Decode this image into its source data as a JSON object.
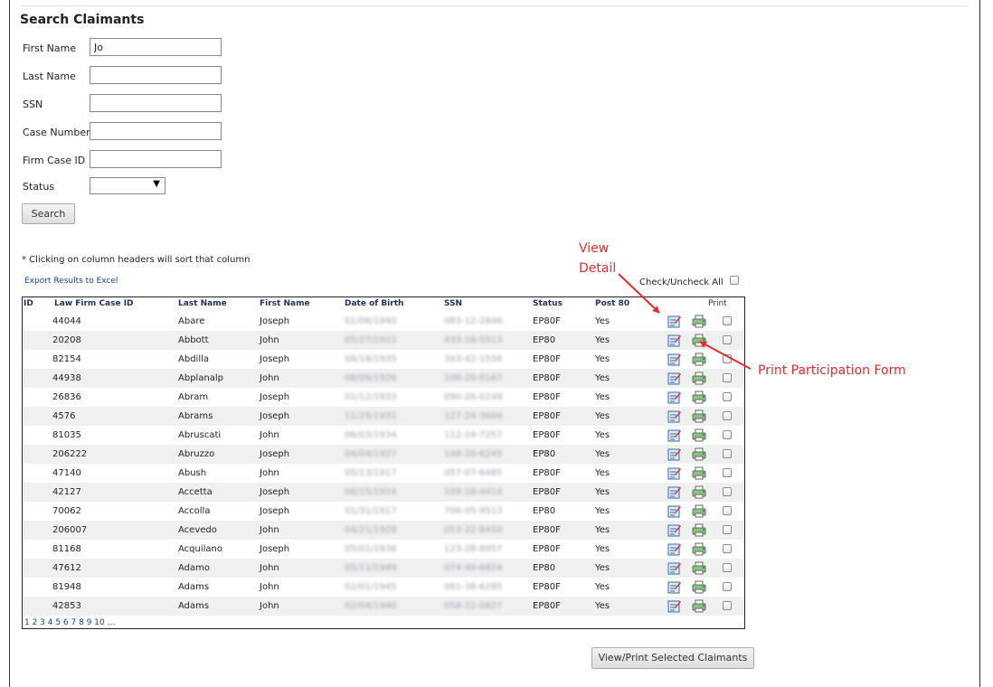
{
  "page_title": "Search Claimants",
  "form": {
    "first_name": {
      "label": "First Name",
      "value": "Jo"
    },
    "last_name": {
      "label": "Last Name",
      "value": ""
    },
    "ssn": {
      "label": "SSN",
      "value": ""
    },
    "case_number": {
      "label": "Case Number",
      "value": ""
    },
    "firm_case_id": {
      "label": "Firm Case ID",
      "value": ""
    },
    "status": {
      "label": "Status",
      "value": ""
    },
    "search_label": "Search"
  },
  "sort_note": "* Clicking on column headers will sort that column",
  "export_label": "Export Results to Excel",
  "check_all_label": "Check/Uncheck All",
  "table": {
    "headers": {
      "id": "ID",
      "firm_case_id": "Law Firm Case ID",
      "last_name": "Last Name",
      "first_name": "First Name",
      "dob": "Date of Birth",
      "ssn": "SSN",
      "status": "Status",
      "post80": "Post 80",
      "print": "Print"
    },
    "rows": [
      {
        "firm_case_id": "44044",
        "last_name": "Abare",
        "first_name": "Joseph",
        "dob": "01/06/1940",
        "ssn": "083-12-2846",
        "status": "EP80F",
        "post80": "Yes"
      },
      {
        "firm_case_id": "20208",
        "last_name": "Abbott",
        "first_name": "John",
        "dob": "05/27/1922",
        "ssn": "433-18-5513",
        "status": "EP80",
        "post80": "Yes"
      },
      {
        "firm_case_id": "82154",
        "last_name": "Abdilla",
        "first_name": "Joseph",
        "dob": "08/18/1935",
        "ssn": "393-42-1556",
        "status": "EP80F",
        "post80": "Yes"
      },
      {
        "firm_case_id": "44938",
        "last_name": "Abplanalp",
        "first_name": "John",
        "dob": "08/09/1926",
        "ssn": "106-20-0167",
        "status": "EP80F",
        "post80": "Yes"
      },
      {
        "firm_case_id": "26836",
        "last_name": "Abram",
        "first_name": "Joseph",
        "dob": "01/12/1933",
        "ssn": "090-26-0249",
        "status": "EP80F",
        "post80": "Yes"
      },
      {
        "firm_case_id": "4576",
        "last_name": "Abrams",
        "first_name": "Joseph",
        "dob": "11/25/1931",
        "ssn": "127-24-3604",
        "status": "EP80F",
        "post80": "Yes"
      },
      {
        "firm_case_id": "81035",
        "last_name": "Abruscati",
        "first_name": "John",
        "dob": "06/03/1934",
        "ssn": "112-24-7257",
        "status": "EP80F",
        "post80": "Yes"
      },
      {
        "firm_case_id": "206222",
        "last_name": "Abruzzo",
        "first_name": "Joseph",
        "dob": "04/04/1927",
        "ssn": "108-20-6245",
        "status": "EP80",
        "post80": "Yes"
      },
      {
        "firm_case_id": "47140",
        "last_name": "Abush",
        "first_name": "John",
        "dob": "05/13/1917",
        "ssn": "057-07-6485",
        "status": "EP80F",
        "post80": "Yes"
      },
      {
        "firm_case_id": "42127",
        "last_name": "Accetta",
        "first_name": "Joseph",
        "dob": "08/15/1924",
        "ssn": "109-18-4414",
        "status": "EP80F",
        "post80": "Yes"
      },
      {
        "firm_case_id": "70062",
        "last_name": "Accolla",
        "first_name": "Joseph",
        "dob": "01/31/1917",
        "ssn": "706-05-9513",
        "status": "EP80",
        "post80": "Yes"
      },
      {
        "firm_case_id": "206007",
        "last_name": "Acevedo",
        "first_name": "John",
        "dob": "04/21/1928",
        "ssn": "053-22-8450",
        "status": "EP80F",
        "post80": "Yes"
      },
      {
        "firm_case_id": "81168",
        "last_name": "Acquilano",
        "first_name": "Joseph",
        "dob": "05/01/1938",
        "ssn": "123-28-8957",
        "status": "EP80F",
        "post80": "Yes"
      },
      {
        "firm_case_id": "47612",
        "last_name": "Adamo",
        "first_name": "John",
        "dob": "05/11/1949",
        "ssn": "074-40-6824",
        "status": "EP80",
        "post80": "Yes"
      },
      {
        "firm_case_id": "81948",
        "last_name": "Adams",
        "first_name": "John",
        "dob": "02/01/1945",
        "ssn": "061-38-6285",
        "status": "EP80F",
        "post80": "Yes"
      },
      {
        "firm_case_id": "42853",
        "last_name": "Adams",
        "first_name": "John",
        "dob": "02/04/1940",
        "ssn": "058-22-0827",
        "status": "EP80F",
        "post80": "Yes"
      }
    ]
  },
  "pagination": "1 2 3 4 5 6 7 8 9 10 ...",
  "view_print_label": "View/Print Selected Claimants",
  "annotations": {
    "view_detail_line1": "View",
    "view_detail_line2": "Detail",
    "print_form": "Print Participation Form"
  },
  "colors": {
    "annotation": "#e52b2b",
    "link": "#1f3f86",
    "header_text": "#1f2f5e"
  },
  "icons": {
    "view_detail": "edit-document-icon",
    "print": "printer-icon"
  }
}
